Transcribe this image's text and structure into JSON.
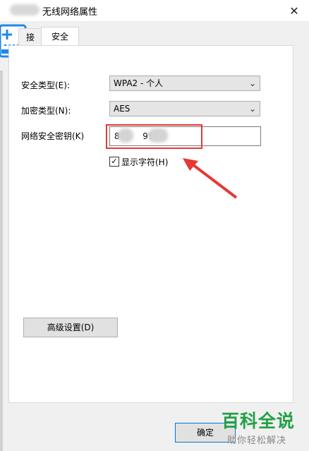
{
  "window": {
    "title": "无线网络属性",
    "close_glyph": "✕"
  },
  "tabs": [
    {
      "label": "接",
      "active": false
    },
    {
      "label": "安全",
      "active": true
    }
  ],
  "security": {
    "type_label": "安全类型(E):",
    "type_value": "WPA2 - 个人",
    "encryption_label": "加密类型(N):",
    "encryption_value": "AES",
    "key_label": "网络安全密钥(K)",
    "key_visible_1": "8",
    "key_visible_2": "99",
    "show_chars_label": "显示字符(H)",
    "show_chars_checked": true
  },
  "buttons": {
    "advanced": "高级设置(D)",
    "ok": "确定"
  },
  "watermark": {
    "title": "百科全说",
    "subtitle": "助你轻松解决"
  },
  "colors": {
    "annotation_red": "#e53935",
    "watermark_green": "#22a045",
    "icon_blue": "#1e88e5"
  }
}
